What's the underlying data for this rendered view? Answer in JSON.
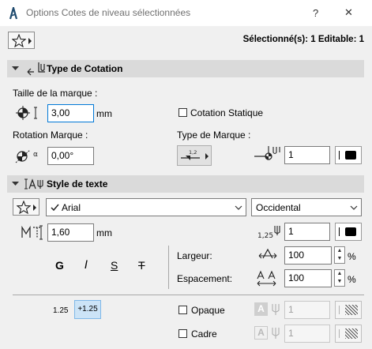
{
  "window": {
    "title": "Options Cotes de niveau sélectionnées",
    "help_label": "?",
    "close_label": "✕"
  },
  "header": {
    "selection_status": "Sélectionné(s): 1 Editable: 1"
  },
  "dimension_type": {
    "section_label": "Type de Cotation",
    "marker_size_label": "Taille de la marque :",
    "marker_size_value": "3,00",
    "marker_size_unit": "mm",
    "static_dimension_label": "Cotation Statique",
    "marker_rotation_label": "Rotation Marque :",
    "marker_rotation_value": "0,00°",
    "marker_type_label": "Type de Marque :",
    "marker_type_glyph": "1,2",
    "pen_value": "1"
  },
  "text_style": {
    "section_label": "Style de texte",
    "font_name": "Arial",
    "script_value": "Occidental",
    "text_size_value": "1,60",
    "text_size_unit": "mm",
    "pen_glyph": "1,25",
    "pen_value": "1",
    "bold_label": "G",
    "italic_label": "I",
    "underline_label": "S",
    "strike_label": "T",
    "width_label": "Largeur:",
    "width_value": "100",
    "width_unit": "%",
    "spacing_label": "Espacement:",
    "spacing_value": "100",
    "spacing_unit": "%"
  },
  "bottom": {
    "format_plain": "1.25",
    "format_signed": "+1.25",
    "opaque_label": "Opaque",
    "frame_label": "Cadre",
    "opaque_pen_value": "1",
    "frame_pen_value": "1"
  }
}
